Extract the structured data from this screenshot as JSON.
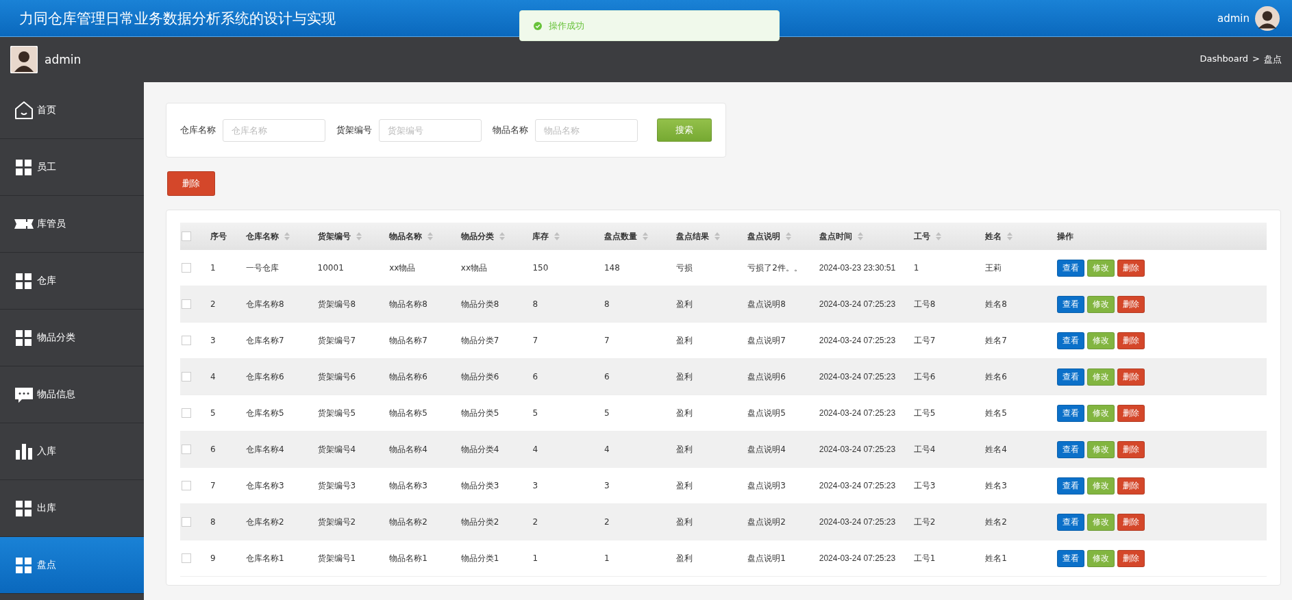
{
  "header": {
    "title": "力同仓库管理日常业务数据分析系统的设计与实现",
    "user": "admin"
  },
  "toast": {
    "kind": "success",
    "message": "操作成功"
  },
  "subbar": {
    "user": "admin",
    "breadcrumb": [
      "Dashboard",
      "盘点"
    ],
    "separator": ">"
  },
  "sidebar": {
    "items": [
      {
        "label": "首页",
        "kind": "home",
        "selected": false
      },
      {
        "label": "员工",
        "kind": "grid",
        "selected": false
      },
      {
        "label": "库管员",
        "kind": "ticket",
        "selected": false
      },
      {
        "label": "仓库",
        "kind": "grid",
        "selected": false
      },
      {
        "label": "物品分类",
        "kind": "grid",
        "selected": false
      },
      {
        "label": "物品信息",
        "kind": "chat",
        "selected": false
      },
      {
        "label": "入库",
        "kind": "bars",
        "selected": false
      },
      {
        "label": "出库",
        "kind": "grid",
        "selected": false
      },
      {
        "label": "盘点",
        "kind": "grid",
        "selected": true
      }
    ]
  },
  "search": {
    "fields": [
      {
        "label": "仓库名称",
        "placeholder": "仓库名称"
      },
      {
        "label": "货架编号",
        "placeholder": "货架编号"
      },
      {
        "label": "物品名称",
        "placeholder": "物品名称"
      }
    ],
    "button": "搜索"
  },
  "bulk_delete": "删除",
  "table": {
    "select_all_checked": false,
    "columns": [
      {
        "label": "序号",
        "sortable": false
      },
      {
        "label": "仓库名称",
        "sortable": true
      },
      {
        "label": "货架编号",
        "sortable": true
      },
      {
        "label": "物品名称",
        "sortable": true
      },
      {
        "label": "物品分类",
        "sortable": true
      },
      {
        "label": "库存",
        "sortable": true
      },
      {
        "label": "盘点数量",
        "sortable": true
      },
      {
        "label": "盘点结果",
        "sortable": true
      },
      {
        "label": "盘点说明",
        "sortable": true
      },
      {
        "label": "盘点时间",
        "sortable": true
      },
      {
        "label": "工号",
        "sortable": true
      },
      {
        "label": "姓名",
        "sortable": true
      },
      {
        "label": "操作",
        "sortable": false
      }
    ],
    "rows": [
      {
        "checked": false,
        "cells": [
          "1",
          "一号仓库",
          "10001",
          "xx物品",
          "xx物品",
          "150",
          "148",
          "亏损",
          "亏损了2件。。",
          "2024-03-23 23:30:51",
          "1",
          "王莉"
        ],
        "actions": [
          "查看",
          "修改",
          "删除"
        ]
      },
      {
        "checked": false,
        "cells": [
          "2",
          "仓库名称8",
          "货架编号8",
          "物品名称8",
          "物品分类8",
          "8",
          "8",
          "盈利",
          "盘点说明8",
          "2024-03-24 07:25:23",
          "工号8",
          "姓名8"
        ],
        "actions": [
          "查看",
          "修改",
          "删除"
        ]
      },
      {
        "checked": false,
        "cells": [
          "3",
          "仓库名称7",
          "货架编号7",
          "物品名称7",
          "物品分类7",
          "7",
          "7",
          "盈利",
          "盘点说明7",
          "2024-03-24 07:25:23",
          "工号7",
          "姓名7"
        ],
        "actions": [
          "查看",
          "修改",
          "删除"
        ]
      },
      {
        "checked": false,
        "cells": [
          "4",
          "仓库名称6",
          "货架编号6",
          "物品名称6",
          "物品分类6",
          "6",
          "6",
          "盈利",
          "盘点说明6",
          "2024-03-24 07:25:23",
          "工号6",
          "姓名6"
        ],
        "actions": [
          "查看",
          "修改",
          "删除"
        ]
      },
      {
        "checked": false,
        "cells": [
          "5",
          "仓库名称5",
          "货架编号5",
          "物品名称5",
          "物品分类5",
          "5",
          "5",
          "盈利",
          "盘点说明5",
          "2024-03-24 07:25:23",
          "工号5",
          "姓名5"
        ],
        "actions": [
          "查看",
          "修改",
          "删除"
        ]
      },
      {
        "checked": false,
        "cells": [
          "6",
          "仓库名称4",
          "货架编号4",
          "物品名称4",
          "物品分类4",
          "4",
          "4",
          "盈利",
          "盘点说明4",
          "2024-03-24 07:25:23",
          "工号4",
          "姓名4"
        ],
        "actions": [
          "查看",
          "修改",
          "删除"
        ]
      },
      {
        "checked": false,
        "cells": [
          "7",
          "仓库名称3",
          "货架编号3",
          "物品名称3",
          "物品分类3",
          "3",
          "3",
          "盈利",
          "盘点说明3",
          "2024-03-24 07:25:23",
          "工号3",
          "姓名3"
        ],
        "actions": [
          "查看",
          "修改",
          "删除"
        ]
      },
      {
        "checked": false,
        "cells": [
          "8",
          "仓库名称2",
          "货架编号2",
          "物品名称2",
          "物品分类2",
          "2",
          "2",
          "盈利",
          "盘点说明2",
          "2024-03-24 07:25:23",
          "工号2",
          "姓名2"
        ],
        "actions": [
          "查看",
          "修改",
          "删除"
        ]
      },
      {
        "checked": false,
        "cells": [
          "9",
          "仓库名称1",
          "货架编号1",
          "物品名称1",
          "物品分类1",
          "1",
          "1",
          "盈利",
          "盘点说明1",
          "2024-03-24 07:25:23",
          "工号1",
          "姓名1"
        ],
        "actions": [
          "查看",
          "修改",
          "删除"
        ]
      }
    ]
  }
}
